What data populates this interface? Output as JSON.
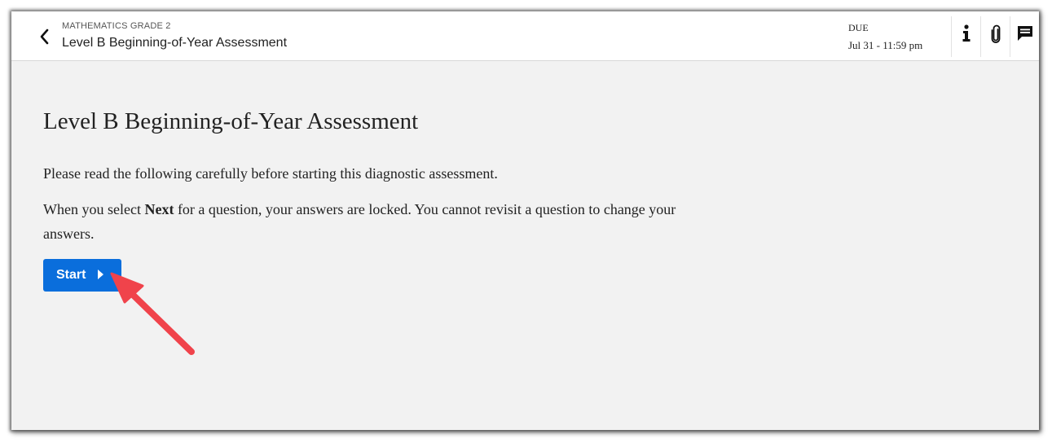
{
  "header": {
    "subject": "MATHEMATICS GRADE 2",
    "title": "Level B Beginning-of-Year Assessment",
    "due_label": "DUE",
    "due_date": "Jul 31 - 11:59 pm",
    "icons": [
      "back-chevron-icon",
      "info-icon",
      "paperclip-icon",
      "comment-icon"
    ]
  },
  "main": {
    "title": "Level B Beginning-of-Year Assessment",
    "intro": "Please read the following carefully before starting this diagnostic assessment.",
    "lock_pre": "When you select ",
    "lock_bold": "Next",
    "lock_post": " for a question, your answers are locked. You cannot revisit a question to change your answers.",
    "start_label": "Start"
  },
  "colors": {
    "accent": "#0a6edc",
    "annotation_arrow": "#f0434b",
    "content_bg": "#f2f2f2"
  }
}
